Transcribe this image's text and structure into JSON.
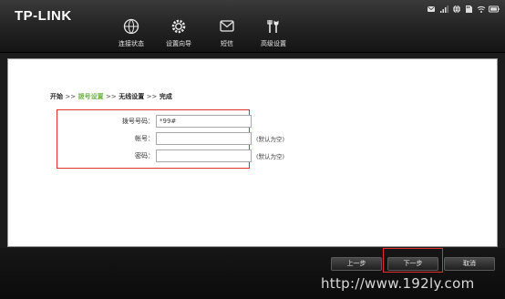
{
  "header": {
    "logo": "TP-LINK",
    "nav": [
      {
        "label": "连接状态",
        "icon": "globe-icon"
      },
      {
        "label": "设置向导",
        "icon": "gear-icon"
      },
      {
        "label": "短信",
        "icon": "envelope-icon"
      },
      {
        "label": "高级设置",
        "icon": "tools-icon"
      }
    ],
    "status_icons": [
      "message-icon",
      "signal-icon",
      "globe-status-icon",
      "sd-card-icon",
      "wifi-icon",
      "battery-icon"
    ]
  },
  "wizard": {
    "breadcrumb": {
      "start": "开始",
      "sep": ">>",
      "step_dial": "拨号设置",
      "step_wireless": "无线设置",
      "step_done": "完成"
    },
    "fields": [
      {
        "label": "拨号号码：",
        "value": "*99#",
        "hint": ""
      },
      {
        "label": "帐号：",
        "value": "",
        "hint": "(默认为空)"
      },
      {
        "label": "密码：",
        "value": "",
        "hint": "(默认为空)"
      }
    ]
  },
  "footer": {
    "prev_label": "上一步",
    "next_label": "下一步",
    "cancel_label": "取消"
  },
  "watermark": "http://www.192ly.com"
}
